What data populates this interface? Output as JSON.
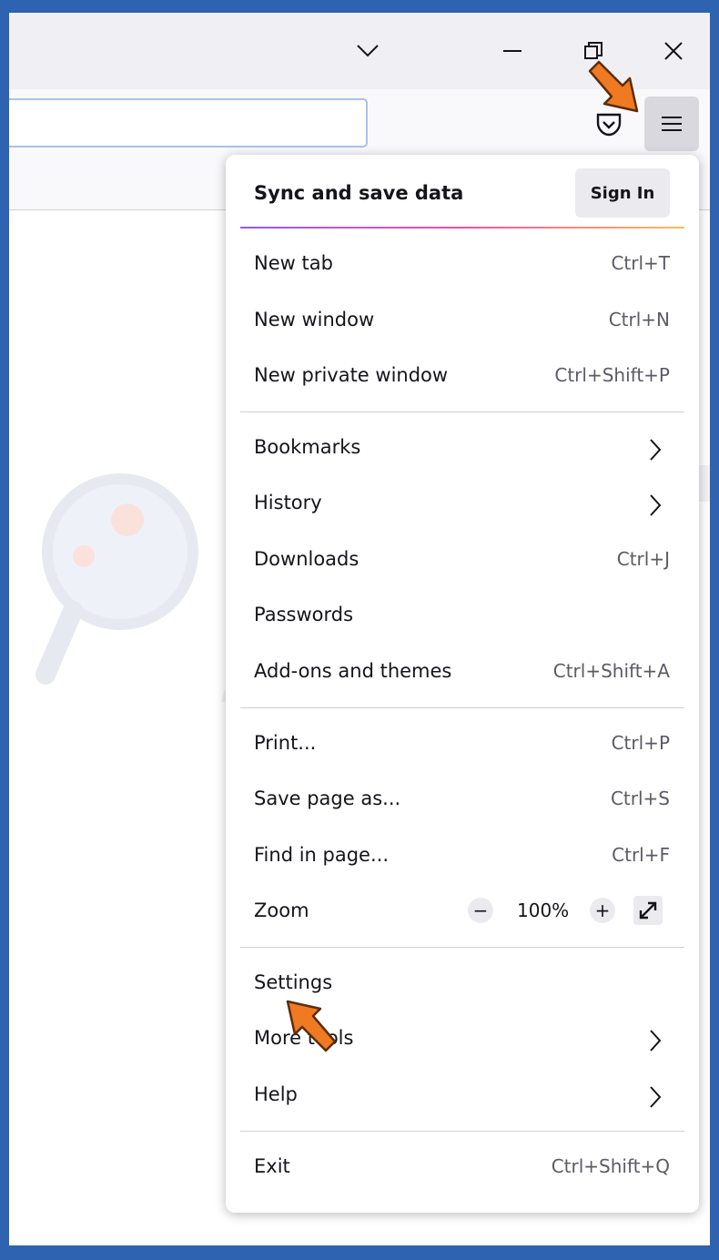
{
  "menu": {
    "sync": {
      "label": "Sync and save data",
      "signin_label": "Sign In"
    },
    "items": [
      {
        "label": "New tab",
        "shortcut": "Ctrl+T"
      },
      {
        "label": "New window",
        "shortcut": "Ctrl+N"
      },
      {
        "label": "New private window",
        "shortcut": "Ctrl+Shift+P"
      },
      {
        "label": "Bookmarks",
        "shortcut": ""
      },
      {
        "label": "History",
        "shortcut": ""
      },
      {
        "label": "Downloads",
        "shortcut": "Ctrl+J"
      },
      {
        "label": "Passwords",
        "shortcut": ""
      },
      {
        "label": "Add-ons and themes",
        "shortcut": "Ctrl+Shift+A"
      },
      {
        "label": "Print...",
        "shortcut": "Ctrl+P"
      },
      {
        "label": "Save page as...",
        "shortcut": "Ctrl+S"
      },
      {
        "label": "Find in page...",
        "shortcut": "Ctrl+F"
      },
      {
        "label": "Settings",
        "shortcut": ""
      },
      {
        "label": "More tools",
        "shortcut": ""
      },
      {
        "label": "Help",
        "shortcut": ""
      },
      {
        "label": "Exit",
        "shortcut": "Ctrl+Shift+Q"
      }
    ],
    "zoom": {
      "label": "Zoom",
      "value": "100%",
      "minus": "−",
      "plus": "+"
    }
  },
  "icons": {
    "titlebar": [
      "chevron-down-icon",
      "minimize-icon",
      "restore-icon",
      "close-icon"
    ],
    "toolbar": [
      "pocket-icon",
      "hamburger-menu-icon"
    ],
    "annotations": [
      "orange-pointer-arrow"
    ]
  },
  "colors": {
    "accent_arrow": "#f07a21",
    "frame": "#2d63b0",
    "menu_bg": "#ffffff",
    "button_bg": "#ebebef"
  }
}
